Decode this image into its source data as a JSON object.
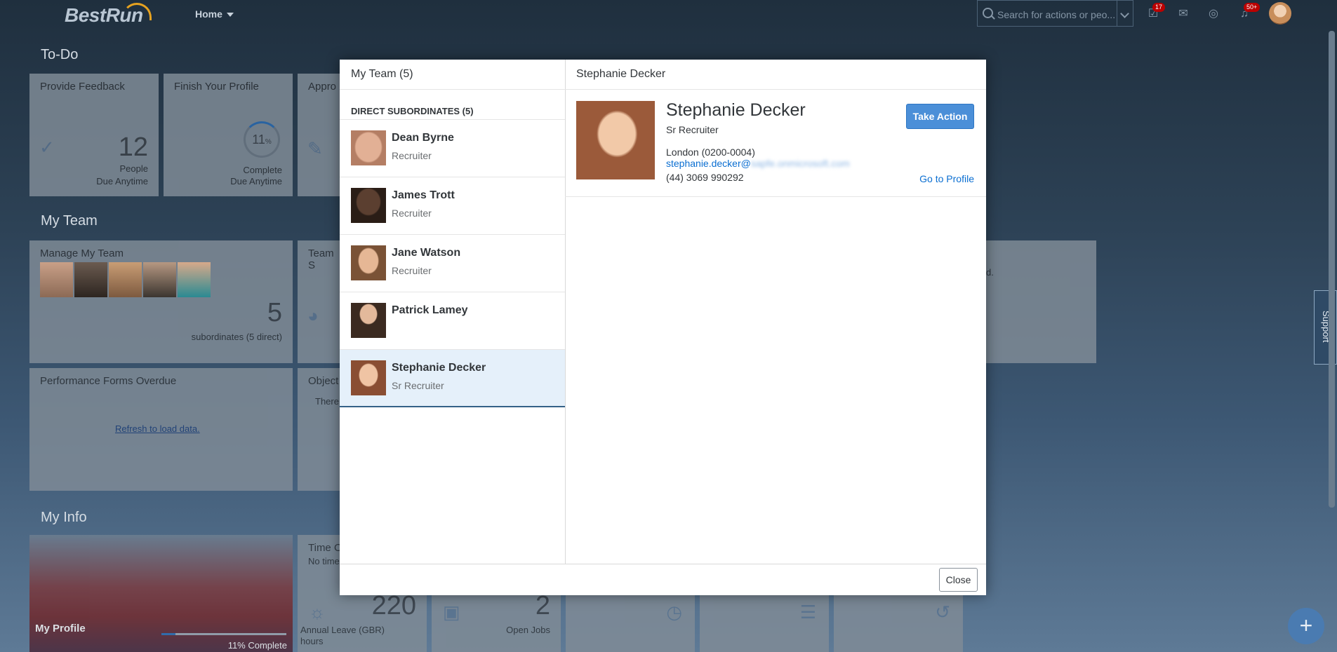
{
  "shell": {
    "logo": "BestRun",
    "home_menu": "Home",
    "search_placeholder": "Search for actions or peo...",
    "badges": {
      "todo": "17",
      "notifications": "50+"
    }
  },
  "sections": {
    "todo": "To-Do",
    "my_team": "My Team",
    "my_info": "My Info"
  },
  "tiles": {
    "provide_feedback": {
      "title": "Provide Feedback",
      "count": "12",
      "line1": "People",
      "line2": "Due Anytime"
    },
    "finish_profile": {
      "title": "Finish Your Profile",
      "percent": "11",
      "unit": "%",
      "line1": "Complete",
      "line2": "Due Anytime"
    },
    "approvals": {
      "title": "Appro"
    },
    "manage_team": {
      "title": "Manage My Team",
      "count": "5",
      "caption": "subordinates (5 direct)"
    },
    "team_s": {
      "title": "Team S"
    },
    "performance_forms": {
      "title": "Performance Forms Overdue",
      "link": "Refresh to load data."
    },
    "objectives": {
      "title": "Object",
      "text": "There"
    },
    "right_snippet": {
      "text": "d."
    },
    "my_profile": {
      "title": "My Profile",
      "complete": "11% Complete",
      "progress": 0.11
    },
    "time_off": {
      "title": "Time O",
      "subtitle": "No time",
      "value": "220",
      "caption1": "Annual Leave (GBR)",
      "caption2": "hours"
    },
    "open_jobs": {
      "value": "2",
      "caption": "Open Jobs"
    }
  },
  "support_label": "Support",
  "fab_label": "+",
  "dialog": {
    "list_title": "My Team (5)",
    "group_header": "DIRECT SUBORDINATES (5)",
    "members": [
      {
        "name": "Dean Byrne",
        "role": "Recruiter"
      },
      {
        "name": "James Trott",
        "role": "Recruiter"
      },
      {
        "name": "Jane Watson",
        "role": "Recruiter"
      },
      {
        "name": "Patrick Lamey",
        "role": ""
      },
      {
        "name": "Stephanie Decker",
        "role": "Sr Recruiter"
      }
    ],
    "detail_title": "Stephanie Decker",
    "detail": {
      "name": "Stephanie Decker",
      "role": "Sr Recruiter",
      "location": "London (0200-0004)",
      "email_visible": "stephanie.decker@",
      "email_blurred": "sapfe.onmicrosoft.com",
      "phone": "(44) 3069 990292",
      "take_action": "Take Action",
      "go_to_profile": "Go to Profile"
    },
    "close_label": "Close"
  }
}
